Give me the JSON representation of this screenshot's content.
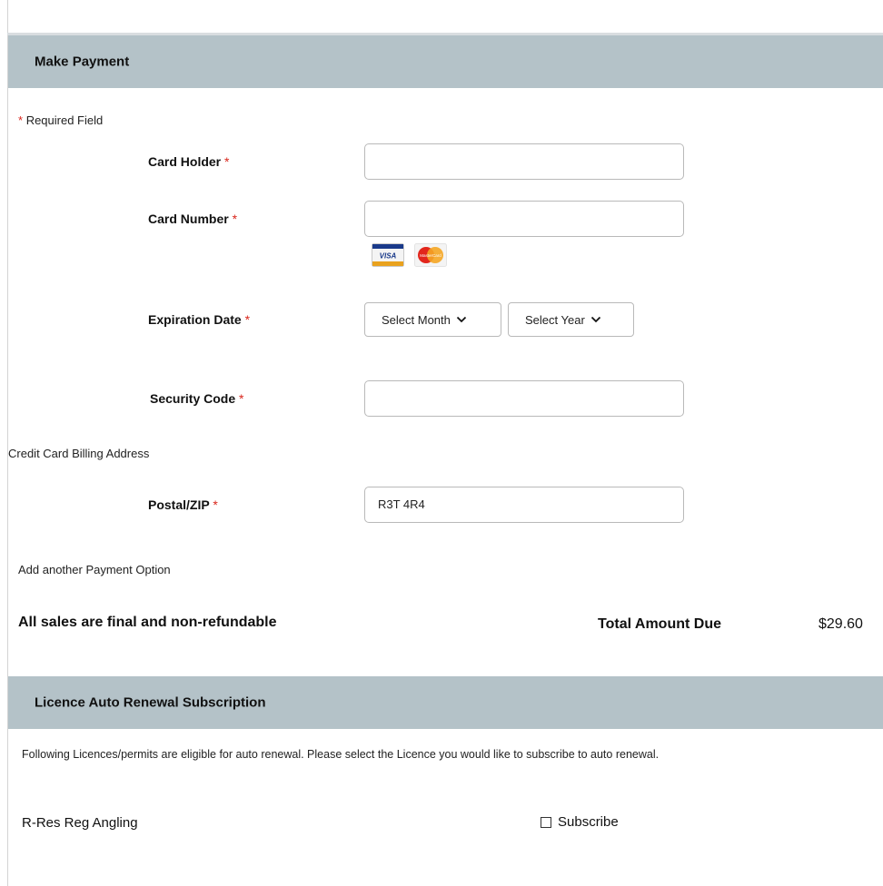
{
  "payment_section": {
    "title": "Make Payment",
    "required_note": "Required Field",
    "required_marker": "*",
    "card_holder": {
      "label": "Card Holder",
      "value": ""
    },
    "card_number": {
      "label": "Card Number",
      "value": ""
    },
    "card_icons": [
      {
        "icon": "visa-card-icon",
        "text": "VISA"
      },
      {
        "icon": "mastercard-icon",
        "text": "MasterCard"
      }
    ],
    "expiration": {
      "label": "Expiration Date",
      "month_select": "Select Month",
      "year_select": "Select Year"
    },
    "security_code": {
      "label": "Security Code",
      "value": ""
    },
    "billing_heading": "Credit Card Billing Address",
    "postal": {
      "label": "Postal/ZIP",
      "value": "R3T 4R4"
    },
    "add_payment_option": "Add another Payment Option",
    "final_notice": "All sales are final and non-refundable",
    "total_label": "Total Amount Due",
    "total_value": "$29.60"
  },
  "renewal_section": {
    "title": "Licence Auto Renewal Subscription",
    "description": "Following Licences/permits are eligible for auto renewal. Please select the Licence you would like to subscribe to auto renewal.",
    "licence_name": "R-Res Reg Angling",
    "subscribe_label": "Subscribe"
  },
  "colors": {
    "header_bg": "#b4c2c8",
    "required_star": "#d9261c",
    "input_border": "#b9b9b9"
  }
}
